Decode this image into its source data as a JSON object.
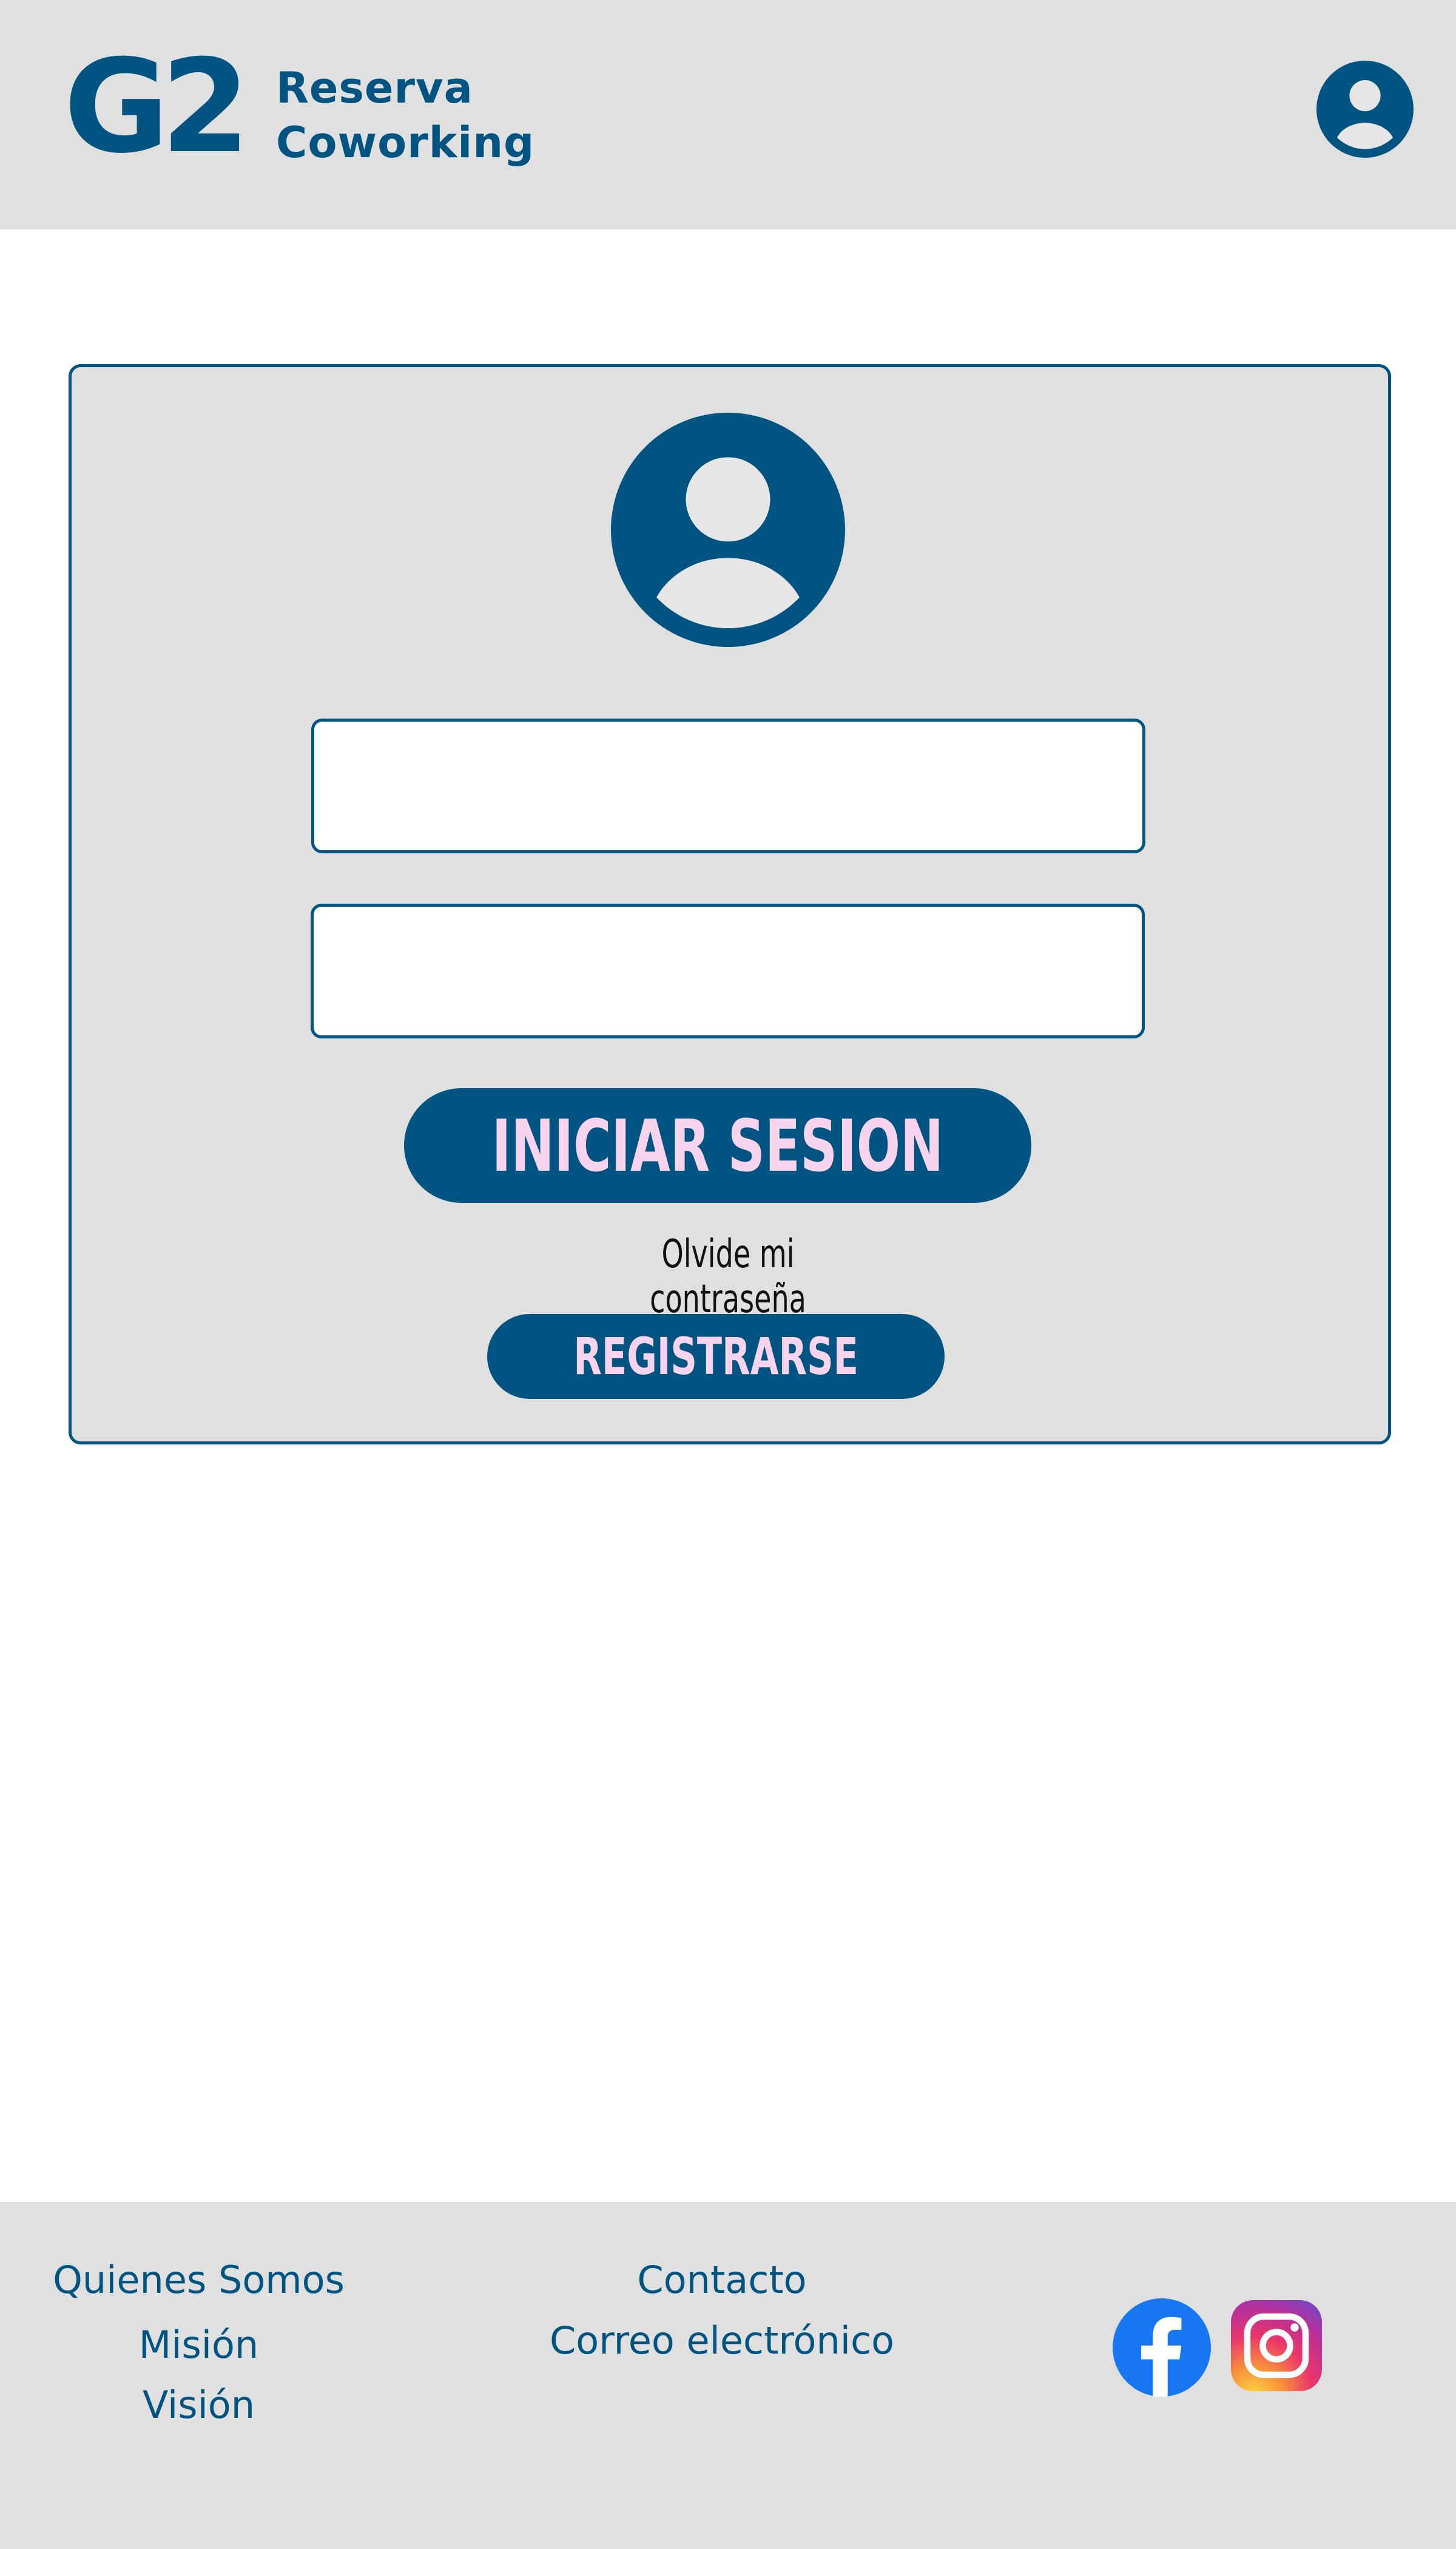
{
  "header": {
    "logo_mark": "G2",
    "logo_line1": "Reserva",
    "logo_line2": "Coworking",
    "avatar_icon": "user-avatar-icon"
  },
  "login": {
    "avatar_icon": "user-avatar-icon",
    "username": {
      "value": "",
      "placeholder": ""
    },
    "password": {
      "value": "",
      "placeholder": ""
    },
    "login_label": "INICIAR SESION",
    "forgot_label": "Olvide mi contraseña",
    "register_label": "REGISTRARSE"
  },
  "footer": {
    "links_col1": [
      "Quienes Somos",
      "Misión",
      "Visión"
    ],
    "links_col2": [
      "Contacto",
      "Correo electrónico"
    ],
    "social": [
      "facebook-icon",
      "instagram-icon"
    ]
  },
  "colors": {
    "brand": "#005482",
    "panel_bg": "#e0e0e1",
    "button_text": "#f9d4ef",
    "facebook": "#1877f2"
  }
}
